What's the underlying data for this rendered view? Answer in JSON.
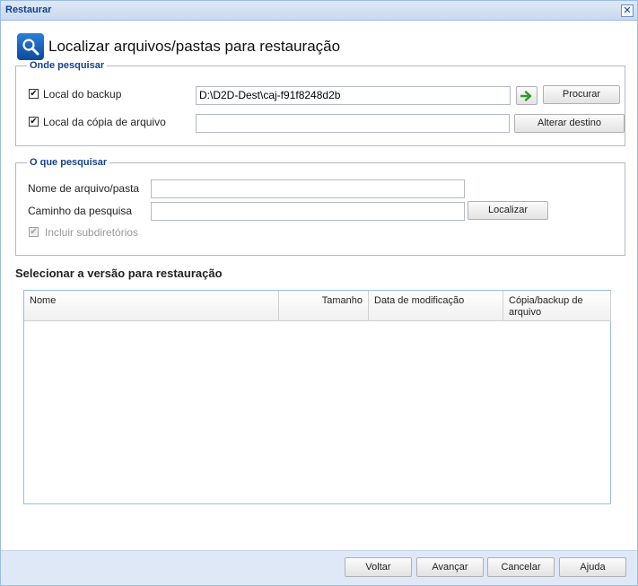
{
  "window": {
    "title": "Restaurar",
    "close_symbol": "✕"
  },
  "header": {
    "title": "Localizar arquivos/pastas para restauração",
    "icon": "search-icon"
  },
  "where": {
    "legend": "Onde pesquisar",
    "backup_location": {
      "label": "Local do backup",
      "checked": true,
      "value": "D:\\D2D-Dest\\caj-f91f8248d2b"
    },
    "go_icon": "green-arrow-icon",
    "browse_label": "Procurar",
    "copy_location": {
      "label": "Local da cópia de arquivo",
      "checked": true,
      "value": ""
    },
    "change_dest_label": "Alterar destino"
  },
  "what": {
    "legend": "O que pesquisar",
    "filename_label": "Nome de arquivo/pasta",
    "filename_value": "",
    "path_label": "Caminho da pesquisa",
    "path_value": "",
    "find_label": "Localizar",
    "subdirs_label": "Incluir subdiretórios",
    "subdirs_checked": true
  },
  "versions": {
    "title": "Selecionar a versão para restauração",
    "columns": [
      "Nome",
      "Tamanho",
      "Data de modificação",
      "Cópia/backup de arquivo"
    ],
    "rows": []
  },
  "footer": {
    "back": "Voltar",
    "next": "Avançar",
    "cancel": "Cancelar",
    "help": "Ajuda"
  },
  "colors": {
    "accent": "#15428b",
    "border": "#99bbe8",
    "arrow": "#2e9a2e"
  }
}
